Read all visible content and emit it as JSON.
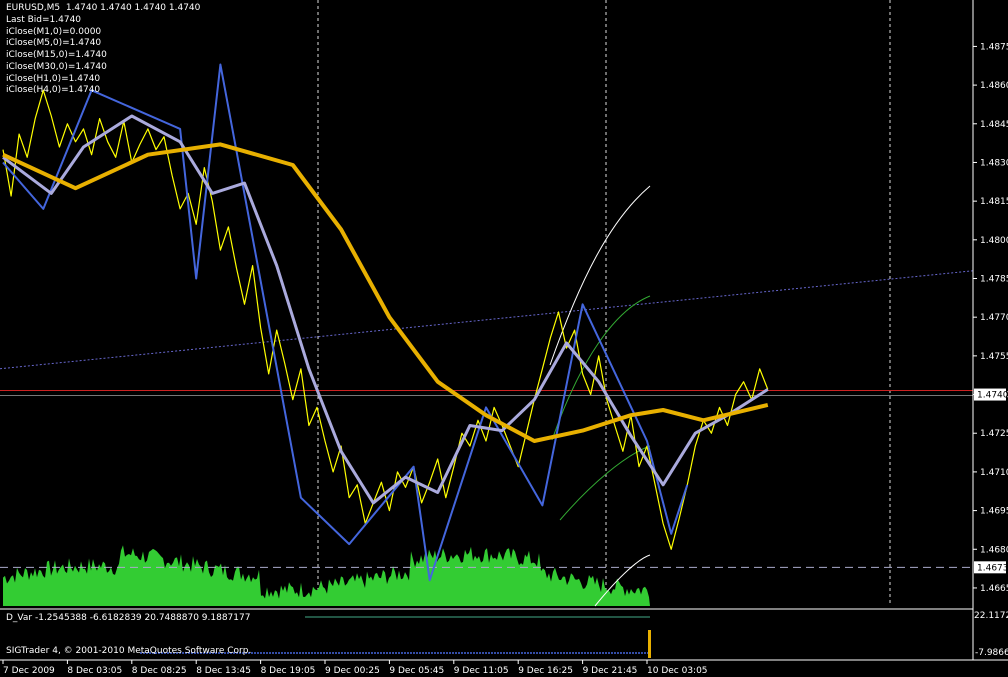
{
  "header": {
    "symbol_line": "EURUSD,M5  1.4740 1.4740 1.4740 1.4740",
    "info_lines": [
      "Last Bid=1.4740",
      "iClose(M1,0)=0.0000",
      "iClose(M5,0)=1.4740",
      "iClose(M15,0)=1.4740",
      "iClose(M30,0)=1.4740",
      "iClose(H1,0)=1.4740",
      "iClose(H4,0)=1.4740"
    ]
  },
  "subwindow": {
    "indicator_label": "D_Var -1.2545388 -6.6182839 20.7488870 9.1887177",
    "copyright": "SIGTrader 4, © 2001-2010 MetaQuotes Software Corp.",
    "scale_top": "22.1172",
    "scale_bottom": "-7.98664"
  },
  "colors": {
    "background": "#000000",
    "price": "#ffff00",
    "zigzag": "#4466dd",
    "fast_ma": "#aaaadd",
    "slow_ma": "#e8b000",
    "volume": "#33cc33",
    "trend_line": "#6666cc",
    "bid_line": "#cc2222",
    "grid": "#ffffff"
  },
  "chart_data": {
    "type": "line",
    "title": "EURUSD,M5",
    "xlabel": "",
    "ylabel": "",
    "ylim": [
      1.4658,
      1.4893
    ],
    "x_ticks": [
      "7 Dec 2009",
      "8 Dec 03:05",
      "8 Dec 08:25",
      "8 Dec 13:45",
      "8 Dec 19:05",
      "9 Dec 00:25",
      "9 Dec 05:45",
      "9 Dec 11:05",
      "9 Dec 16:25",
      "9 Dec 21:45",
      "10 Dec 03:05"
    ],
    "y_ticks": [
      "1.4665",
      "1.4680",
      "1.4695",
      "1.4710",
      "1.4725",
      "1.4740",
      "1.4755",
      "1.4770",
      "1.4785",
      "1.4800",
      "1.4815",
      "1.4830",
      "1.4845",
      "1.4860",
      "1.4875"
    ],
    "current_price": "1.4740",
    "marked_level": "1.4673",
    "grid": "vertical dotted",
    "series": [
      {
        "points": [
          [
            0,
            1.4835
          ],
          [
            0.05,
            1.4817
          ],
          [
            0.1,
            1.4841
          ],
          [
            0.15,
            1.4832
          ],
          [
            0.2,
            1.4847
          ],
          [
            0.25,
            1.4858
          ],
          [
            0.3,
            1.4848
          ],
          [
            0.35,
            1.4836
          ],
          [
            0.4,
            1.4845
          ],
          [
            0.45,
            1.4838
          ],
          [
            0.5,
            1.4843
          ],
          [
            0.55,
            1.4833
          ],
          [
            0.6,
            1.4847
          ],
          [
            0.65,
            1.4838
          ],
          [
            0.7,
            1.4832
          ],
          [
            0.75,
            1.4846
          ],
          [
            0.8,
            1.483
          ],
          [
            0.85,
            1.4837
          ],
          [
            0.9,
            1.4843
          ],
          [
            0.95,
            1.4835
          ],
          [
            1,
            1.484
          ],
          [
            1.05,
            1.4825
          ],
          [
            1.1,
            1.4812
          ],
          [
            1.15,
            1.4818
          ],
          [
            1.2,
            1.4806
          ],
          [
            1.25,
            1.4828
          ],
          [
            1.3,
            1.4815
          ],
          [
            1.35,
            1.4796
          ],
          [
            1.4,
            1.4805
          ],
          [
            1.45,
            1.4789
          ],
          [
            1.5,
            1.4775
          ],
          [
            1.55,
            1.479
          ],
          [
            1.6,
            1.4766
          ],
          [
            1.65,
            1.4748
          ],
          [
            1.7,
            1.4765
          ],
          [
            1.75,
            1.4752
          ],
          [
            1.8,
            1.4738
          ],
          [
            1.85,
            1.475
          ],
          [
            1.9,
            1.4728
          ],
          [
            1.95,
            1.4735
          ],
          [
            2,
            1.4722
          ],
          [
            2.05,
            1.471
          ],
          [
            2.1,
            1.472
          ],
          [
            2.15,
            1.47
          ],
          [
            2.2,
            1.4705
          ],
          [
            2.25,
            1.469
          ],
          [
            2.3,
            1.4698
          ],
          [
            2.35,
            1.4706
          ],
          [
            2.4,
            1.4695
          ],
          [
            2.45,
            1.471
          ],
          [
            2.5,
            1.4704
          ],
          [
            2.55,
            1.4712
          ],
          [
            2.6,
            1.4698
          ],
          [
            2.65,
            1.4706
          ],
          [
            2.7,
            1.4715
          ],
          [
            2.75,
            1.47
          ],
          [
            2.8,
            1.4712
          ],
          [
            2.85,
            1.4725
          ],
          [
            2.9,
            1.472
          ],
          [
            2.95,
            1.473
          ],
          [
            3,
            1.4722
          ],
          [
            3.05,
            1.4735
          ],
          [
            3.1,
            1.4728
          ],
          [
            3.15,
            1.472
          ],
          [
            3.2,
            1.4712
          ],
          [
            3.25,
            1.4725
          ],
          [
            3.3,
            1.4738
          ],
          [
            3.35,
            1.475
          ],
          [
            3.4,
            1.4762
          ],
          [
            3.45,
            1.4772
          ],
          [
            3.5,
            1.4758
          ],
          [
            3.55,
            1.4765
          ],
          [
            3.6,
            1.4748
          ],
          [
            3.65,
            1.474
          ],
          [
            3.7,
            1.4755
          ],
          [
            3.75,
            1.4738
          ],
          [
            3.8,
            1.4728
          ],
          [
            3.85,
            1.4718
          ],
          [
            3.9,
            1.4732
          ],
          [
            3.95,
            1.4712
          ],
          [
            4,
            1.472
          ],
          [
            4.05,
            1.4705
          ],
          [
            4.1,
            1.469
          ],
          [
            4.15,
            1.468
          ],
          [
            4.2,
            1.4692
          ],
          [
            4.25,
            1.4705
          ],
          [
            4.3,
            1.472
          ],
          [
            4.35,
            1.473
          ],
          [
            4.4,
            1.4725
          ],
          [
            4.45,
            1.4735
          ],
          [
            4.5,
            1.4728
          ],
          [
            4.55,
            1.474
          ],
          [
            4.6,
            1.4745
          ],
          [
            4.65,
            1.4738
          ],
          [
            4.7,
            1.475
          ],
          [
            4.75,
            1.4742
          ]
        ],
        "color": "#ffff00"
      },
      {
        "points": [
          [
            0,
            1.483
          ],
          [
            0.25,
            1.4812
          ],
          [
            0.55,
            1.4858
          ],
          [
            1.1,
            1.4843
          ],
          [
            1.2,
            1.4785
          ],
          [
            1.35,
            1.4868
          ],
          [
            1.85,
            1.47
          ],
          [
            2.15,
            1.4682
          ],
          [
            2.55,
            1.4712
          ],
          [
            2.65,
            1.4668
          ],
          [
            3.0,
            1.4735
          ],
          [
            3.35,
            1.4697
          ],
          [
            3.6,
            1.4775
          ],
          [
            4.0,
            1.4722
          ],
          [
            4.15,
            1.4686
          ],
          [
            4.25,
            1.4705
          ]
        ],
        "color": "#4466dd"
      },
      {
        "points": [
          [
            0,
            1.4832
          ],
          [
            0.3,
            1.4818
          ],
          [
            0.5,
            1.4836
          ],
          [
            0.8,
            1.4848
          ],
          [
            1.1,
            1.4838
          ],
          [
            1.3,
            1.4818
          ],
          [
            1.5,
            1.4822
          ],
          [
            1.7,
            1.479
          ],
          [
            1.9,
            1.475
          ],
          [
            2.1,
            1.4718
          ],
          [
            2.3,
            1.4698
          ],
          [
            2.5,
            1.4708
          ],
          [
            2.7,
            1.4702
          ],
          [
            2.9,
            1.4728
          ],
          [
            3.1,
            1.4726
          ],
          [
            3.3,
            1.4738
          ],
          [
            3.5,
            1.476
          ],
          [
            3.7,
            1.4745
          ],
          [
            3.9,
            1.4724
          ],
          [
            4.1,
            1.4705
          ],
          [
            4.3,
            1.4725
          ],
          [
            4.5,
            1.4732
          ],
          [
            4.75,
            1.4742
          ]
        ],
        "color": "#aaaadd"
      },
      {
        "points": [
          [
            0,
            1.4833
          ],
          [
            0.45,
            1.482
          ],
          [
            0.9,
            1.4833
          ],
          [
            1.35,
            1.4837
          ],
          [
            1.8,
            1.4829
          ],
          [
            2.1,
            1.4804
          ],
          [
            2.4,
            1.477
          ],
          [
            2.7,
            1.4745
          ],
          [
            3.0,
            1.4732
          ],
          [
            3.3,
            1.4722
          ],
          [
            3.6,
            1.4726
          ],
          [
            3.9,
            1.4732
          ],
          [
            4.1,
            1.4734
          ],
          [
            4.35,
            1.473
          ],
          [
            4.75,
            1.4736
          ]
        ],
        "color": "#e8b000"
      }
    ]
  }
}
